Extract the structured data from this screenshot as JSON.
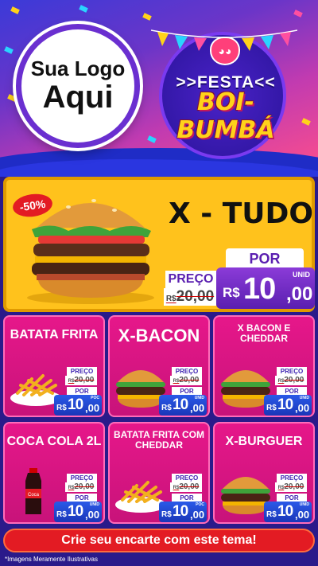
{
  "logo": {
    "line1": "Sua Logo",
    "line2": "Aqui"
  },
  "event": {
    "festa": ">>FESTA<<",
    "name": "BOI-BUMBÁ"
  },
  "featured": {
    "discount": "-50%",
    "title": "X - TUDO",
    "preco_label": "PREÇO",
    "old_price_currency": "R$",
    "old_price": "20,00",
    "por_label": "POR",
    "currency": "R$",
    "price_int": "10",
    "price_cents": ",00",
    "unit": "UNID"
  },
  "products": [
    {
      "title": "BATATA FRITA",
      "preco_label": "PREÇO",
      "old_currency": "R$",
      "old_price": "20,00",
      "por_label": "POR",
      "currency": "R$",
      "price_int": "10",
      "price_cents": ",00",
      "unit": "POC",
      "food": "fries"
    },
    {
      "title": "X-BACON",
      "preco_label": "PREÇO",
      "old_currency": "R$",
      "old_price": "20,00",
      "por_label": "POR",
      "currency": "R$",
      "price_int": "10",
      "price_cents": ",00",
      "unit": "UNID",
      "food": "burger"
    },
    {
      "title": "X BACON E CHEDDAR",
      "preco_label": "PREÇO",
      "old_currency": "R$",
      "old_price": "20,00",
      "por_label": "POR",
      "currency": "R$",
      "price_int": "10",
      "price_cents": ",00",
      "unit": "UNID",
      "food": "burger"
    },
    {
      "title": "COCA COLA 2L",
      "preco_label": "PREÇO",
      "old_currency": "R$",
      "old_price": "20,00",
      "por_label": "POR",
      "currency": "R$",
      "price_int": "10",
      "price_cents": ",00",
      "unit": "UNID",
      "food": "soda"
    },
    {
      "title": "BATATA FRITA COM CHEDDAR",
      "preco_label": "PREÇO",
      "old_currency": "R$",
      "old_price": "20,00",
      "por_label": "POR",
      "currency": "R$",
      "price_int": "10",
      "price_cents": ",00",
      "unit": "POC",
      "food": "fries"
    },
    {
      "title": "X-BURGUER",
      "preco_label": "PREÇO",
      "old_currency": "R$",
      "old_price": "20,00",
      "por_label": "POR",
      "currency": "R$",
      "price_int": "10",
      "price_cents": ",00",
      "unit": "UNID",
      "food": "burger"
    }
  ],
  "cta": "Crie seu encarte com este tema!",
  "footnote": "*Imagens Meramente Ilustrativas",
  "colors": {
    "card_bg": "#e6178a",
    "featured_bg": "#ffc21c",
    "price_purple": "#5a1fb0",
    "price_blue": "#1a36b8",
    "cta_red": "#e31b23"
  }
}
